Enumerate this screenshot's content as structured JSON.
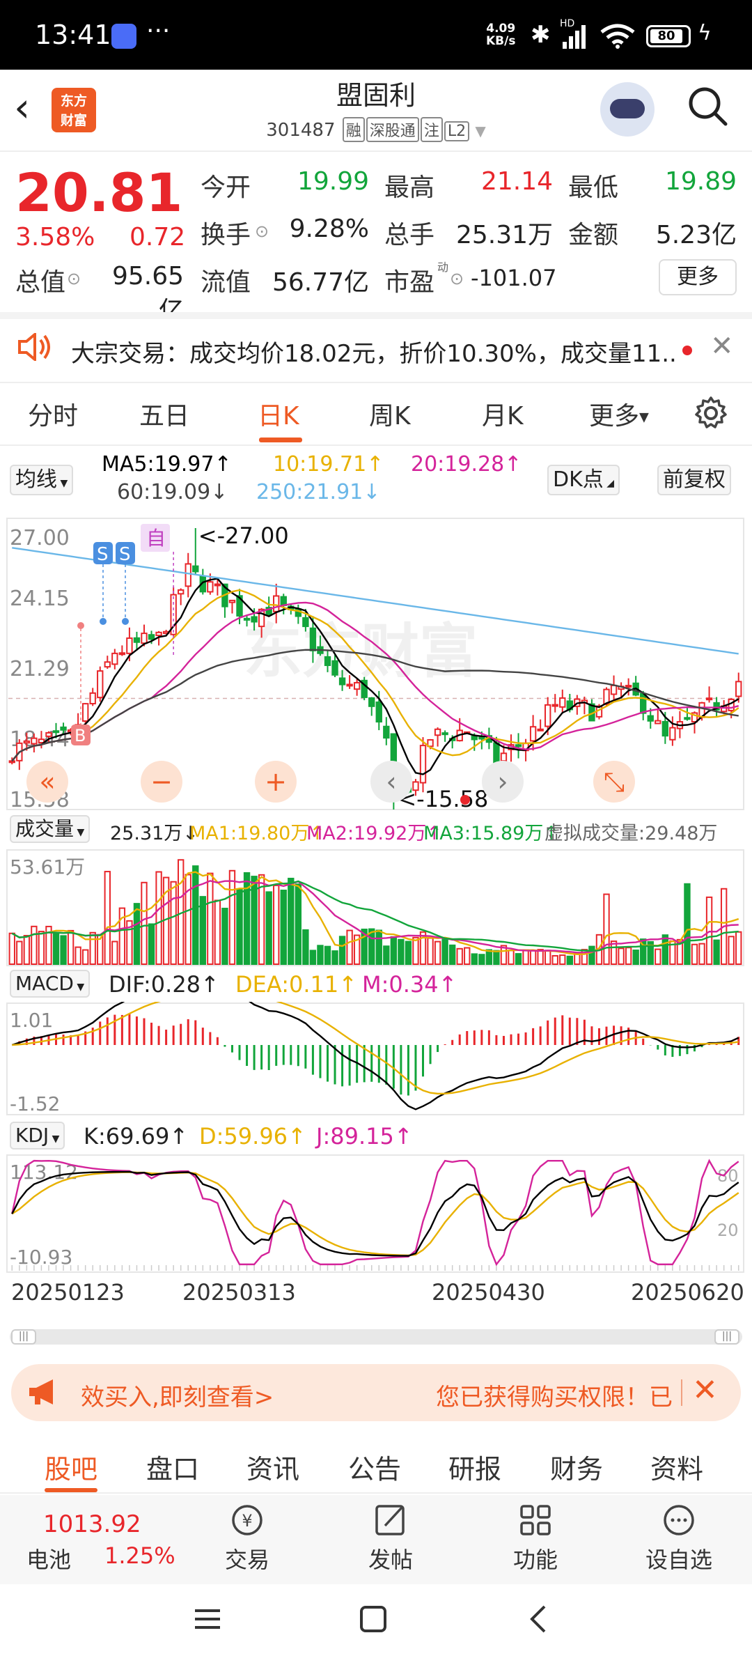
{
  "status_bar": {
    "time": "13:41",
    "net_speed": "4.09",
    "net_unit": "KB/s",
    "battery": "80",
    "hd": "HD",
    "dots": "···"
  },
  "header": {
    "logo_line1": "东方",
    "logo_line2": "财富",
    "name": "盟固利",
    "code": "301487",
    "tags": [
      "融",
      "深股通",
      "注",
      "L2"
    ]
  },
  "quote": {
    "price": "20.81",
    "change_pct": "3.58%",
    "change_val": "0.72",
    "open_label": "今开",
    "open": "19.99",
    "high_label": "最高",
    "high": "21.14",
    "low_label": "最低",
    "low": "19.89",
    "turnover_label": "换手",
    "turnover": "9.28%",
    "volume_label": "总手",
    "volume": "25.31万",
    "amount_label": "金额",
    "amount": "5.23亿",
    "mktcap_label": "总值",
    "mktcap": "95.65亿",
    "float_label": "流值",
    "float_cap": "56.77亿",
    "pe_label": "市盈",
    "pe_sup": "动",
    "pe": "-101.07",
    "more": "更多"
  },
  "notice": {
    "text": "大宗交易：成交均价18.02元，折价10.30%，成交量11.."
  },
  "period_tabs": [
    "分时",
    "五日",
    "日K",
    "周K",
    "月K",
    "更多"
  ],
  "ma": {
    "selector": "均线",
    "ma5": "MA5:19.97↑",
    "ma10": "10:19.71↑",
    "ma20": "20:19.28↑",
    "ma60": "60:19.09↓",
    "ma250": "250:21.91↓",
    "dk": "DK点",
    "adjust": "前复权"
  },
  "kline": {
    "y_labels": [
      "27.00",
      "24.15",
      "21.29",
      "18.44",
      "15.58"
    ],
    "max_label": "<-27.00",
    "min_label": "<-15.58",
    "badges": [
      "S",
      "S",
      "B",
      "自"
    ],
    "watermark": "东方财富"
  },
  "volume": {
    "selector": "成交量",
    "value": "25.31万↓",
    "ma1": "MA1:19.80万↑",
    "ma2": "MA2:19.92万↑",
    "ma3": "MA3:15.89万↑",
    "virtual": "虚拟成交量:29.48万",
    "max_label": "53.61万"
  },
  "macd": {
    "selector": "MACD",
    "dif": "DIF:0.28↑",
    "dea": "DEA:0.11↑",
    "m": "M:0.34↑",
    "top": "1.01",
    "bottom": "-1.52"
  },
  "kdj": {
    "selector": "KDJ",
    "k": "K:69.69↑",
    "d": "D:59.96↑",
    "j": "J:89.15↑",
    "top": "113.12",
    "bottom": "-10.93",
    "l80": "80",
    "l20": "20"
  },
  "dates": [
    "20250123",
    "20250313",
    "20250430",
    "20250620"
  ],
  "promo": {
    "left": "效买入,即刻查看>",
    "right": "您已获得购买权限！已"
  },
  "bottom_tabs": [
    "股吧",
    "盘口",
    "资讯",
    "公告",
    "研报",
    "财务",
    "资料"
  ],
  "action_bar": {
    "index_value": "1013.92",
    "index_name": "电池",
    "index_pct": "1.25%",
    "items": [
      "交易",
      "发帖",
      "功能",
      "设自选"
    ]
  },
  "colors": {
    "up": "#e8262b",
    "down": "#12a53b",
    "accent": "#ee5a24",
    "ma5": "#000000",
    "ma10": "#e8b100",
    "ma20": "#d4239a",
    "ma60": "#444444",
    "ma250": "#6ab7e8"
  }
}
